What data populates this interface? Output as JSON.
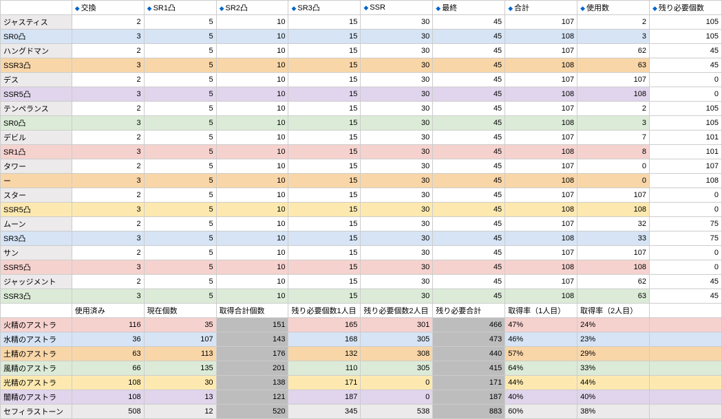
{
  "top_headers": [
    "",
    "交換",
    "SR1凸",
    "SR2凸",
    "SR3凸",
    "SSR",
    "最終",
    "合計",
    "使用数",
    "残り必要個数"
  ],
  "top_rows": [
    {
      "label": "ジャスティス",
      "cls": "c-gray",
      "v": [
        2,
        5,
        10,
        15,
        30,
        45,
        107,
        2,
        105
      ]
    },
    {
      "label": "SR0凸",
      "cls": "c-blue",
      "v": [
        3,
        5,
        10,
        15,
        30,
        45,
        108,
        3,
        105
      ]
    },
    {
      "label": "ハングドマン",
      "cls": "c-gray",
      "v": [
        2,
        5,
        10,
        15,
        30,
        45,
        107,
        62,
        45
      ]
    },
    {
      "label": "SSR3凸",
      "cls": "c-orange",
      "v": [
        3,
        5,
        10,
        15,
        30,
        45,
        108,
        63,
        45
      ]
    },
    {
      "label": "デス",
      "cls": "c-gray",
      "v": [
        2,
        5,
        10,
        15,
        30,
        45,
        107,
        107,
        0
      ]
    },
    {
      "label": "SSR5凸",
      "cls": "c-purp",
      "v": [
        3,
        5,
        10,
        15,
        30,
        45,
        108,
        108,
        0
      ]
    },
    {
      "label": "テンペランス",
      "cls": "c-gray",
      "v": [
        2,
        5,
        10,
        15,
        30,
        45,
        107,
        2,
        105
      ]
    },
    {
      "label": "SR0凸",
      "cls": "c-green",
      "v": [
        3,
        5,
        10,
        15,
        30,
        45,
        108,
        3,
        105
      ]
    },
    {
      "label": "デビル",
      "cls": "c-gray",
      "v": [
        2,
        5,
        10,
        15,
        30,
        45,
        107,
        7,
        101
      ]
    },
    {
      "label": "SR1凸",
      "cls": "c-pink",
      "v": [
        3,
        5,
        10,
        15,
        30,
        45,
        108,
        8,
        101
      ]
    },
    {
      "label": "タワー",
      "cls": "c-gray",
      "v": [
        2,
        5,
        10,
        15,
        30,
        45,
        107,
        0,
        107
      ]
    },
    {
      "label": "ー",
      "cls": "c-orange",
      "v": [
        3,
        5,
        10,
        15,
        30,
        45,
        108,
        0,
        108
      ]
    },
    {
      "label": "スター",
      "cls": "c-gray",
      "v": [
        2,
        5,
        10,
        15,
        30,
        45,
        107,
        107,
        0
      ]
    },
    {
      "label": "SSR5凸",
      "cls": "c-yellow",
      "v": [
        3,
        5,
        10,
        15,
        30,
        45,
        108,
        108,
        0
      ]
    },
    {
      "label": "ムーン",
      "cls": "c-gray",
      "v": [
        2,
        5,
        10,
        15,
        30,
        45,
        107,
        32,
        75
      ]
    },
    {
      "label": "SR3凸",
      "cls": "c-blue",
      "v": [
        3,
        5,
        10,
        15,
        30,
        45,
        108,
        33,
        75
      ]
    },
    {
      "label": "サン",
      "cls": "c-gray",
      "v": [
        2,
        5,
        10,
        15,
        30,
        45,
        107,
        107,
        0
      ]
    },
    {
      "label": "SSR5凸",
      "cls": "c-pink",
      "v": [
        3,
        5,
        10,
        15,
        30,
        45,
        108,
        108,
        0
      ]
    },
    {
      "label": "ジャッジメント",
      "cls": "c-gray",
      "v": [
        2,
        5,
        10,
        15,
        30,
        45,
        107,
        62,
        45
      ]
    },
    {
      "label": "SSR3凸",
      "cls": "c-green",
      "v": [
        3,
        5,
        10,
        15,
        30,
        45,
        108,
        63,
        45
      ]
    }
  ],
  "bot_headers": [
    "",
    "使用済み",
    "現在個数",
    "取得合計個数",
    "残り必要個数1人目",
    "残り必要個数2人目",
    "残り必要合計",
    "取得率（1人目）",
    "取得率（2人目）"
  ],
  "bot_rows": [
    {
      "label": "火精のアストラ",
      "cls": "c-fire",
      "v": [
        116,
        35,
        151,
        165,
        301,
        466,
        "47%",
        "24%"
      ]
    },
    {
      "label": "水精のアストラ",
      "cls": "c-water",
      "v": [
        36,
        107,
        143,
        168,
        305,
        473,
        "46%",
        "23%"
      ]
    },
    {
      "label": "土精のアストラ",
      "cls": "c-earth",
      "v": [
        63,
        113,
        176,
        132,
        308,
        440,
        "57%",
        "29%"
      ]
    },
    {
      "label": "風精のアストラ",
      "cls": "c-wind",
      "v": [
        66,
        135,
        201,
        110,
        305,
        415,
        "64%",
        "33%"
      ]
    },
    {
      "label": "光精のアストラ",
      "cls": "c-light",
      "v": [
        108,
        30,
        138,
        171,
        0,
        171,
        "44%",
        "44%"
      ]
    },
    {
      "label": "闇精のアストラ",
      "cls": "c-dark",
      "v": [
        108,
        13,
        121,
        187,
        0,
        187,
        "40%",
        "40%"
      ]
    },
    {
      "label": "セフィラストーン",
      "cls": "c-gray",
      "v": [
        508,
        12,
        520,
        345,
        538,
        883,
        "60%",
        "38%"
      ]
    }
  ]
}
